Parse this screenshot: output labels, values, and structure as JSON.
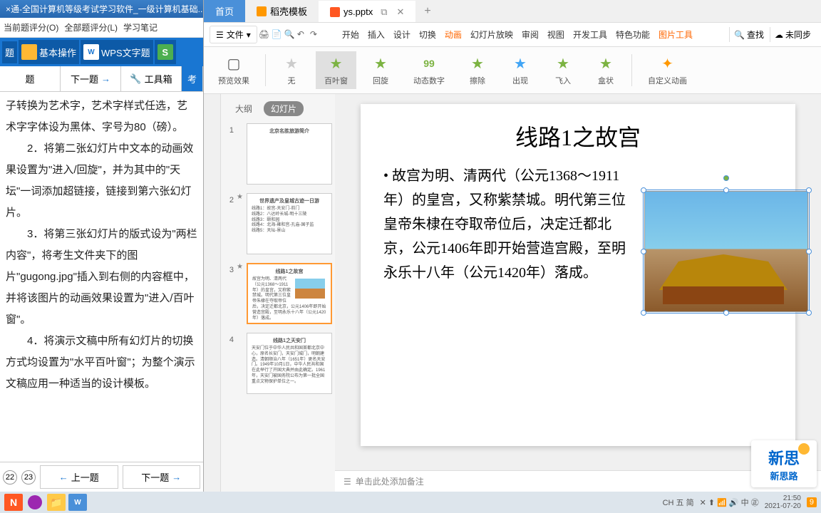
{
  "left": {
    "title": "×通-全国计算机等级考试学习软件_一级计算机基础...",
    "menu": {
      "m1": "当前题评分(O)",
      "m2": "全部题评分(L)",
      "m3": "学习笔记"
    },
    "tabs": {
      "t1": "题",
      "t2": "基本操作",
      "t3": "WPS文字题",
      "t4": "S"
    },
    "tools": {
      "prev": "题",
      "next": "下一题",
      "kit": "工具箱",
      "exam": "考"
    },
    "body": "子转换为艺术字，艺术字样式任选，艺术字字体设为黑体、字号为80（磅）。\n　　2．将第二张幻灯片中文本的动画效果设置为\"进入/回旋\"，并为其中的\"天坛\"一词添加超链接，链接到第六张幻灯片。\n　　3．将第三张幻灯片的版式设为\"两栏内容\"，将考生文件夹下的图片\"gugong.jpg\"插入到右侧的内容框中，并将该图片的动画效果设置为\"进入/百叶窗\"。\n　　4．将演示文稿中所有幻灯片的切换方式均设置为\"水平百叶窗\"；为整个演示文稿应用一种适当的设计模板。",
    "pgA": "22",
    "pgB": "23",
    "navPrev": "上一题",
    "navNext": "下一题"
  },
  "wps": {
    "tabs": {
      "home": "首页",
      "tpl": "稻壳模板",
      "file": "ys.pptx"
    },
    "menu": {
      "file": "文件",
      "items": [
        "开始",
        "插入",
        "设计",
        "切换",
        "动画",
        "幻灯片放映",
        "审阅",
        "视图",
        "开发工具",
        "特色功能",
        "图片工具"
      ],
      "search": "查找",
      "sync": "未同步"
    },
    "ribbon": {
      "preview": "预览效果",
      "none": "无",
      "blinds": "百叶窗",
      "spin": "回旋",
      "dynum": "动态数字",
      "wipe": "擦除",
      "appear": "出现",
      "flyin": "飞入",
      "box": "盒状",
      "custom": "自定义动画"
    },
    "thumbs": {
      "outline": "大纲",
      "slides": "幻灯片",
      "s1": {
        "n": "1",
        "title": "北京名胜旅游简介"
      },
      "s2": {
        "n": "2",
        "title": "世界遗产及皇城古迹一日游",
        "body": "线路1：故宫-天安门-前门\n线路2：八达岭长城-明十三陵\n线路3：颐和园\n线路4：北海-雍和宫-孔庙-国子监\n线路5：天坛-景山"
      },
      "s3": {
        "n": "3",
        "title": "线路1之故宫",
        "body": "故宫为明、清两代（公元1368～1911年）的皇宫，又称紫禁城。明代第三位皇帝朱棣在夺取帝位后，决定迁都北京，公元1406年即开始营造宫殿，至明永乐十八年（公元1420年）落成。"
      },
      "s4": {
        "n": "4",
        "title": "线路1之天安门",
        "body": "天安门位于中华人民共和国首都北京中心，原名长安门，天安门城门，明朝建造。清朝顺治八年（1651年）更名天安门。1949年10月1日，中华人民共和国在此举行了开国大典并由此确定。1961年，天安门被国务院公布为第一批全国重点文物保护单位之一。"
      }
    },
    "slide": {
      "title": "线路1之故宫",
      "text": "故宫为明、清两代（公元1368～1911年）的皇宫，又称紫禁城。明代第三位皇帝朱棣在夺取帝位后，决定迁都北京，公元1406年即开始营造宫殿，至明永乐十八年（公元1420年）落成。"
    },
    "notes": "单击此处添加备注"
  },
  "logo": {
    "top": "新思",
    "sub": "新思路"
  },
  "taskbar": {
    "ime": "CH 五 简",
    "icons": "✕ ⬆ 📶 🔊 中 ㊣",
    "time": "21:50",
    "date": "2021-07-20",
    "badge": "9"
  }
}
